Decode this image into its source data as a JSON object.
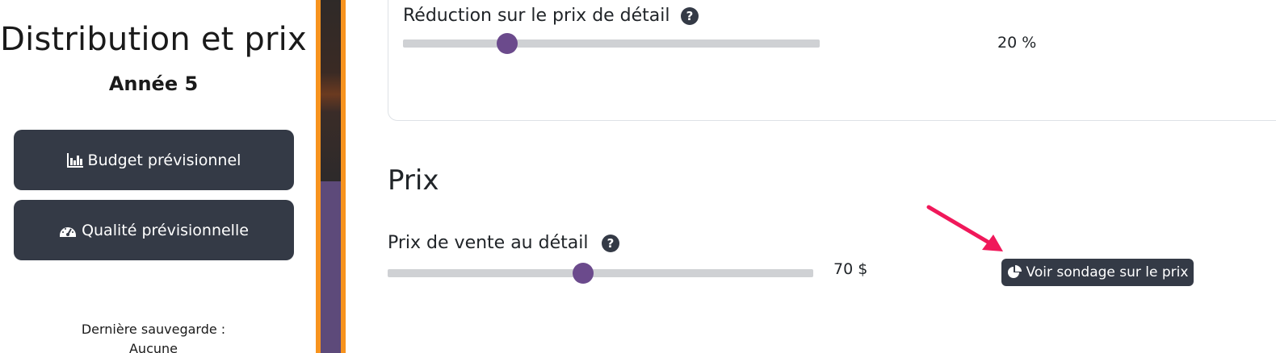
{
  "sidebar": {
    "title": "Distribution et prix",
    "subtitle": "Année 5",
    "buttons": [
      {
        "label": "Budget prévisionnel",
        "icon": "chart-bar-icon"
      },
      {
        "label": "Qualité prévisionnelle",
        "icon": "gauge-icon"
      }
    ],
    "save_label": "Dernière sauvegarde :",
    "save_value": "Aucune"
  },
  "discount": {
    "label": "Réduction sur le prix de détail",
    "value_text": "20 %",
    "slider_fraction": 0.25
  },
  "price_section": {
    "title": "Prix",
    "retail_label": "Prix de vente au détail",
    "value_text": "70 $",
    "slider_fraction": 0.46,
    "survey_button": "Voir sondage sur le prix"
  },
  "colors": {
    "button_bg": "#343a46",
    "accent_orange": "#f7931e",
    "slider_thumb": "#6b4a8c",
    "arrow": "#f0185a"
  }
}
